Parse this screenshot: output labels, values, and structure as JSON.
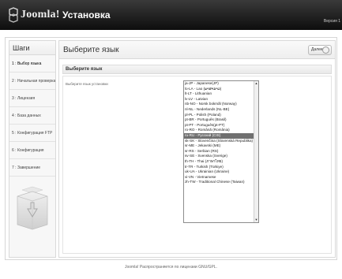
{
  "header": {
    "logo_text": "Joomla!",
    "title": "Установка",
    "version": "Версия 1"
  },
  "sidebar": {
    "title": "Шаги",
    "steps": [
      "1 : Выбор языка",
      "2 : Начальная проверка",
      "3 : Лицензия",
      "4 : База данных",
      "5 : Конфигурация FTP",
      "6 : Конфигурация",
      "7 : Завершение"
    ],
    "active_step_index": 0
  },
  "main": {
    "heading": "Выберите язык",
    "next_button": "Далее",
    "section_title": "Выберите язык",
    "field_label": "Выберите язык установки",
    "languages": [
      "ja-JP - Japanese(JP)",
      "lo-LA - Lao (ພາສາລາວ)",
      "lt-LT - Lithuanian",
      "lv-LV - Latvian",
      "nb-NO - Norsk bokmål (Norway)",
      "nl-NL - Nederlands (NL-BE)",
      "pl-PL - Polish (Poland)",
      "pt-BR - Português (Brasil)",
      "pt-PT - Português(pt-PT)",
      "ro-RO - Română (România)",
      "ru-RU - Русский (CIS)",
      "sk-SK - Slovenčina (Slovenská Republika)",
      "sr-ME - Jekavski (ME)",
      "sr-RS - Serbian (RS)",
      "sv-SE - Svenska (Sverige)",
      "th-TH - Thai (ภาษาไทย)",
      "tr-TR - Turkish (Türkiye)",
      "uk-UA - Ukrainian (Ukraine)",
      "vi-VN - Vietnamese",
      "zh-TW - Traditional Chinese (Taiwan)"
    ],
    "selected_language_index": 10
  },
  "footer": {
    "text": "Joomla! Распространяется по лицензии GNU/GPL."
  },
  "colors": {
    "header_bg": "#111111",
    "selected_bg": "#707070"
  }
}
